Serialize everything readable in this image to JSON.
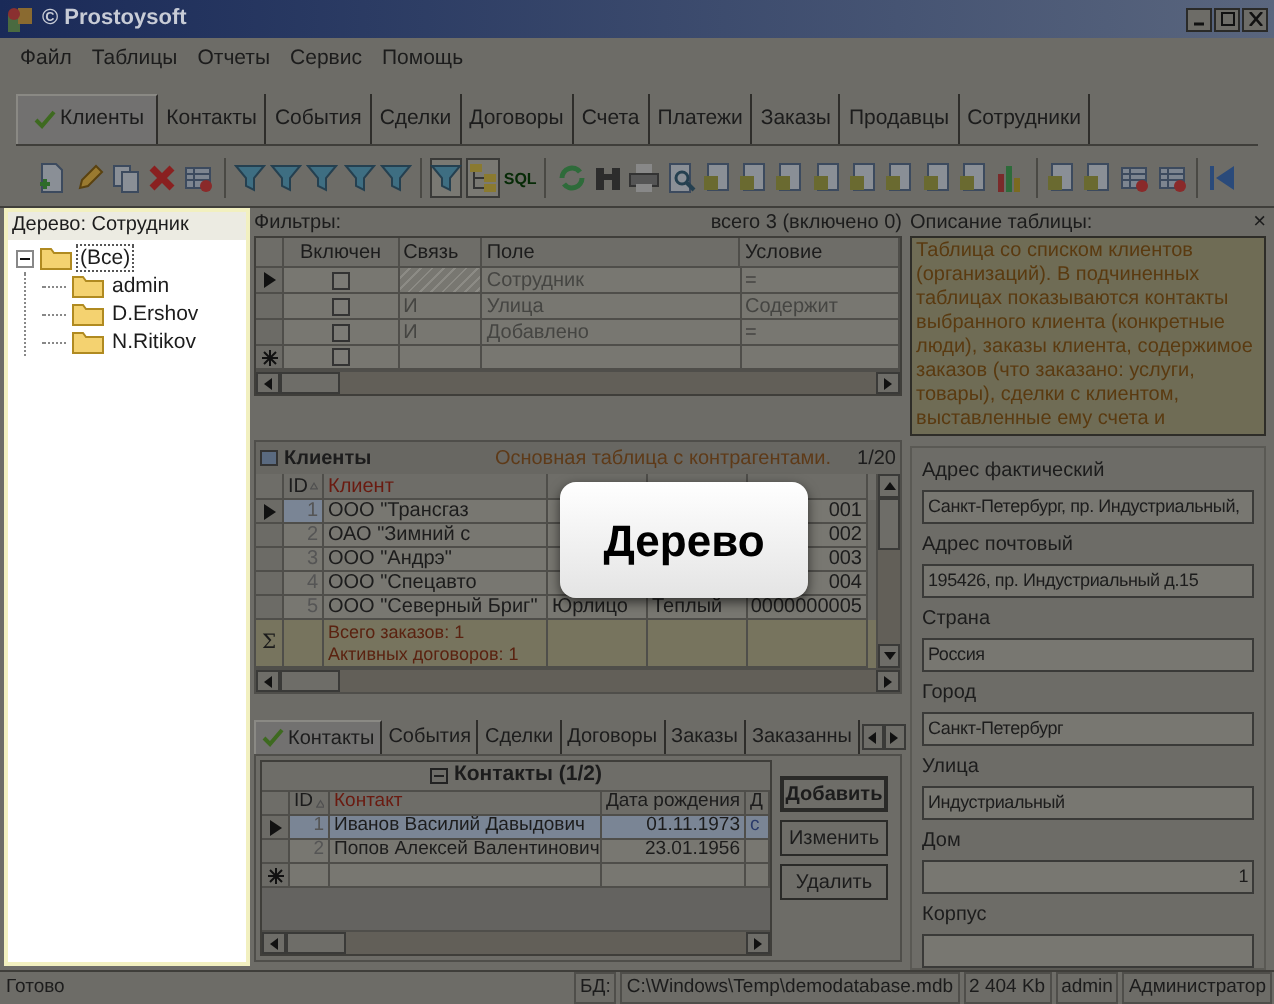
{
  "window": {
    "title": "© Prostoysoft"
  },
  "menu": [
    "Файл",
    "Таблицы",
    "Отчеты",
    "Сервис",
    "Помощь"
  ],
  "tabs": [
    {
      "label": "Клиенты",
      "selected": true
    },
    {
      "label": "Контакты",
      "selected": false
    },
    {
      "label": "События",
      "selected": false
    },
    {
      "label": "Сделки",
      "selected": false
    },
    {
      "label": "Договоры",
      "selected": false
    },
    {
      "label": "Счета",
      "selected": false
    },
    {
      "label": "Платежи",
      "selected": false
    },
    {
      "label": "Заказы",
      "selected": false
    },
    {
      "label": "Продавцы",
      "selected": false
    },
    {
      "label": "Сотрудники",
      "selected": false
    }
  ],
  "toolbar": [
    [
      {
        "kind": "document",
        "selected": false
      },
      {
        "kind": "pencil",
        "selected": false
      },
      {
        "kind": "copy",
        "selected": false
      },
      {
        "kind": "cross",
        "selected": false
      },
      {
        "kind": "grid",
        "selected": false
      }
    ],
    [
      {
        "kind": "funnel",
        "selected": false
      },
      {
        "kind": "funnel",
        "selected": false
      },
      {
        "kind": "funnel",
        "selected": false
      },
      {
        "kind": "funnel",
        "selected": false
      },
      {
        "kind": "funnel",
        "selected": false
      }
    ],
    [
      {
        "kind": "funnel",
        "selected": true
      },
      {
        "kind": "tree",
        "selected": true
      },
      {
        "kind": "sql",
        "label": "SQL",
        "selected": false
      }
    ],
    [
      {
        "kind": "refresh",
        "selected": false
      },
      {
        "kind": "binoculars",
        "selected": false
      },
      {
        "kind": "printer",
        "selected": false
      },
      {
        "kind": "magnifier",
        "selected": false
      },
      {
        "kind": "page",
        "selected": false
      },
      {
        "kind": "page",
        "selected": false
      },
      {
        "kind": "page",
        "selected": false
      },
      {
        "kind": "page",
        "selected": false
      },
      {
        "kind": "page",
        "selected": false
      },
      {
        "kind": "page",
        "selected": false
      },
      {
        "kind": "page",
        "selected": false
      },
      {
        "kind": "page",
        "selected": false
      },
      {
        "kind": "chart",
        "selected": false
      }
    ],
    [
      {
        "kind": "page",
        "selected": false
      },
      {
        "kind": "page",
        "selected": false
      },
      {
        "kind": "grid",
        "selected": false
      },
      {
        "kind": "grid",
        "selected": false
      }
    ],
    [
      {
        "kind": "first",
        "selected": false
      }
    ]
  ],
  "tree": {
    "title": "Дерево: Сотрудник",
    "items": [
      {
        "label": "(Все)",
        "selected": true,
        "expanded": true,
        "children": [
          {
            "label": "admin",
            "selected": false
          },
          {
            "label": "D.Ershov",
            "selected": false
          },
          {
            "label": "N.Ritikov",
            "selected": false
          }
        ]
      }
    ]
  },
  "filters": {
    "title": "Фильтры:",
    "summary": "всего 3 (включено 0)",
    "columns": [
      "Включен",
      "Связь",
      "Поле",
      "Условие"
    ],
    "rows": [
      {
        "kind": "data",
        "selected": true,
        "checked": false,
        "link_disabled": true,
        "field": "Сотрудник",
        "condition": "="
      },
      {
        "kind": "data",
        "selected": false,
        "checked": false,
        "link_disabled": false,
        "link": "И",
        "field": "Улица",
        "condition": "Содержит"
      },
      {
        "kind": "data",
        "selected": false,
        "checked": false,
        "link_disabled": false,
        "link": "И",
        "field": "Добавлено",
        "condition": "="
      },
      {
        "kind": "new",
        "selected": false,
        "checked": false,
        "link_disabled": false
      }
    ]
  },
  "clients": {
    "title": "Клиенты",
    "description": "Основная таблица с контрагентами.",
    "position": "1/20",
    "columns": [
      "ID",
      "Клиент"
    ],
    "rows": [
      {
        "id": "1",
        "client": "ООО \"Трансгаз",
        "column_5": "001",
        "selected": true
      },
      {
        "id": "2",
        "client": "ОАО \"Зимний с",
        "column_5": "002",
        "selected": false
      },
      {
        "id": "3",
        "client": "ООО \"Андрэ\"",
        "column_5": "003",
        "selected": false
      },
      {
        "id": "4",
        "client": "ООО \"Спецавто",
        "column_5": "004",
        "selected": false
      },
      {
        "id": "5",
        "client": "ООО \"Северный Бриг\"",
        "column_3": "Юрлицо",
        "column_4": "Теплый",
        "column_5": "0000000005",
        "selected": false
      }
    ],
    "totals_label": "Σ",
    "totals": [
      "Всего заказов: 1",
      "Активных договоров: 1"
    ]
  },
  "popup": {
    "text": "Дерево"
  },
  "subtabs": [
    {
      "label": "Контакты",
      "selected": true
    },
    {
      "label": "События",
      "selected": false
    },
    {
      "label": "Сделки",
      "selected": false
    },
    {
      "label": "Договоры",
      "selected": false
    },
    {
      "label": "Заказы",
      "selected": false
    },
    {
      "label": "Заказанны",
      "selected": false
    }
  ],
  "contacts": {
    "title": "Контакты (1/2)",
    "columns": [
      "ID",
      "Контакт",
      "Дата рождения",
      "Д"
    ],
    "rows": [
      {
        "kind": "data",
        "id": "1",
        "contact": "Иванов Василий Давыдович",
        "birth_date": "01.11.1973",
        "column_4": "с",
        "selected": true
      },
      {
        "kind": "data",
        "id": "2",
        "contact": "Попов Алексей Валентинович",
        "birth_date": "23.01.1956",
        "selected": false
      },
      {
        "kind": "new",
        "selected": false
      }
    ]
  },
  "buttons": [
    {
      "label": "Добавить",
      "default": true
    },
    {
      "label": "Изменить",
      "default": false
    },
    {
      "label": "Удалить",
      "default": false
    }
  ],
  "description": {
    "title": "Описание таблицы:",
    "close": "×",
    "text": "Таблица со списком клиентов (организаций). В подчиненных таблицах показываются контакты выбранного клиента (конкретные люди), заказы клиента, содержимое заказов (что заказано: услуги, товары), сделки с клиентом, выставленные ему счета и"
  },
  "fields": [
    {
      "kind": "text",
      "label": "Адрес фактический",
      "value": "Санкт-Петербург, пр. Индустриальный,"
    },
    {
      "kind": "text",
      "label": "Адрес почтовый",
      "value": "195426, пр. Индустриальный д.15"
    },
    {
      "kind": "text",
      "label": "Страна",
      "value": "Россия"
    },
    {
      "kind": "text",
      "label": "Город",
      "value": "Санкт-Петербург"
    },
    {
      "kind": "text",
      "label": "Улица",
      "value": "Индустриальный"
    },
    {
      "kind": "number",
      "label": "Дом",
      "value": "1"
    },
    {
      "kind": "text",
      "label": "Корпус"
    }
  ],
  "status_bar": {
    "text": "Готово",
    "panels": [
      "БД:",
      "C:\\Windows\\Temp\\demodatabase.mdb",
      "2 404 Kb",
      "admin",
      "Администратор"
    ]
  }
}
